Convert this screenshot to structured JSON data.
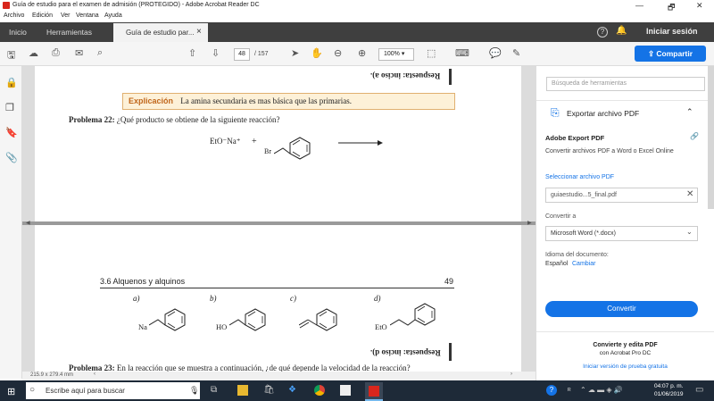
{
  "window": {
    "title": "Guía de estudio para el examen de admisión (PROTEGIDO) - Adobe Acrobat Reader DC",
    "min": "—",
    "max": "🗗",
    "close": "✕"
  },
  "menu": [
    "Archivo",
    "Edición",
    "Ver",
    "Ventana",
    "Ayuda"
  ],
  "tabs": {
    "home": "Inicio",
    "tools": "Herramientas",
    "doc": "Guía de estudio par...",
    "doc_close": "×",
    "signin": "Iniciar sesión"
  },
  "toolbar": {
    "page_current": "48",
    "page_total": "/ 157",
    "zoom": "100%",
    "share": "Compartir"
  },
  "page1": {
    "upside_text": "Respuesta: inciso a).",
    "explain_label": "Explicación",
    "explain_text": "La amina secundaria es mas básica que las primarias.",
    "problem_label": "Problema 22:",
    "problem_text": "¿Qué producto se obtiene de la siguiente reacción?",
    "reagent": "EtO⁻Na⁺",
    "plus": "+",
    "br": "Br"
  },
  "page2": {
    "section": "3.6  Alquenos y alquinos",
    "page_num": "49",
    "options": [
      "a)",
      "b)",
      "c)",
      "d)"
    ],
    "substituents": [
      "Na",
      "HO",
      "",
      "EtO"
    ],
    "upside_text": "Respuesta: inciso d).",
    "problem_label": "Problema 23:",
    "problem_text": "En la reacción que se muestra a continuación, ¿de qué depende la velocidad de la reacción?"
  },
  "status": {
    "size": "215.9 x 279.4 mm"
  },
  "rightpane": {
    "search_placeholder": "Búsqueda de herramientas",
    "export_title": "Exportar archivo PDF",
    "service": "Adobe Export PDF",
    "service_desc": "Convertir archivos PDF a Word o Excel Online",
    "select_label": "Seleccionar archivo PDF",
    "file_name": "guiaestudio...5_final.pdf",
    "convert_to": "Convertir a",
    "format": "Microsoft Word (*.docx)",
    "lang_label": "Idioma del documento:",
    "lang_value": "Español",
    "lang_change": "Cambiar",
    "convert_btn": "Convertir",
    "promo_title": "Convierte y edita PDF",
    "promo_sub": "con Acrobat Pro DC",
    "trial": "Iniciar versión de prueba gratuita"
  },
  "taskbar": {
    "search": "Escribe aquí para buscar",
    "time": "04:07 p. m.",
    "date": "01/06/2019"
  },
  "colors": {
    "accent": "#1473e6",
    "explain_bg": "#fdf1d8",
    "explain_label": "#c0661a",
    "taskbar": "#1e2a38"
  }
}
